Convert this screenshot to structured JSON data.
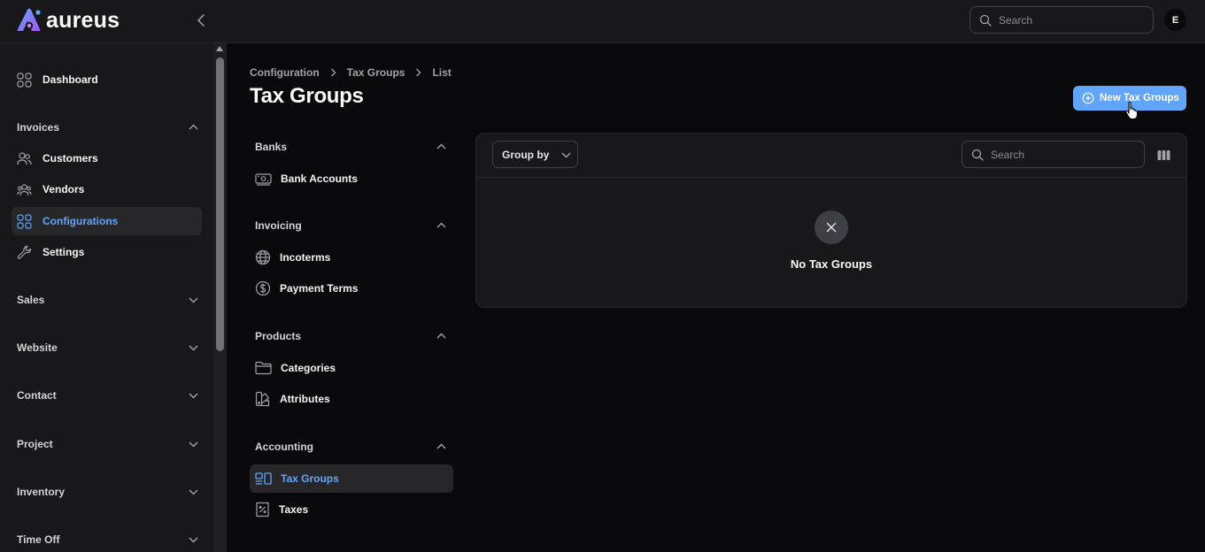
{
  "app": {
    "name": "aureus",
    "user_initial": "E",
    "search_placeholder": "Search"
  },
  "sidebar": {
    "top_items": [
      {
        "label": "Dashboard",
        "icon": "grid-icon"
      }
    ],
    "groups": [
      {
        "label": "Invoices",
        "expanded": true,
        "items": [
          {
            "label": "Customers",
            "icon": "users-icon"
          },
          {
            "label": "Vendors",
            "icon": "user-group-icon"
          },
          {
            "label": "Configurations",
            "icon": "grid-icon",
            "active": true
          },
          {
            "label": "Settings",
            "icon": "wrench-icon"
          }
        ]
      },
      {
        "label": "Sales",
        "expanded": false
      },
      {
        "label": "Website",
        "expanded": false
      },
      {
        "label": "Contact",
        "expanded": false
      },
      {
        "label": "Project",
        "expanded": false
      },
      {
        "label": "Inventory",
        "expanded": false
      },
      {
        "label": "Time Off",
        "expanded": false
      }
    ]
  },
  "breadcrumb": [
    "Configuration",
    "Tax Groups",
    "List"
  ],
  "page": {
    "title": "Tax Groups",
    "new_button": "New Tax Groups"
  },
  "subnav": [
    {
      "label": "Banks",
      "items": [
        {
          "label": "Bank Accounts",
          "icon": "bank-icon"
        }
      ]
    },
    {
      "label": "Invoicing",
      "items": [
        {
          "label": "Incoterms",
          "icon": "globe-icon"
        },
        {
          "label": "Payment Terms",
          "icon": "dollar-icon"
        }
      ]
    },
    {
      "label": "Products",
      "items": [
        {
          "label": "Categories",
          "icon": "folder-icon"
        },
        {
          "label": "Attributes",
          "icon": "swatch-icon"
        }
      ]
    },
    {
      "label": "Accounting",
      "items": [
        {
          "label": "Tax Groups",
          "icon": "tax-groups-icon",
          "active": true
        },
        {
          "label": "Taxes",
          "icon": "receipt-percent-icon"
        }
      ]
    }
  ],
  "table": {
    "group_by_label": "Group by",
    "search_placeholder": "Search",
    "empty_message": "No Tax Groups"
  },
  "colors": {
    "accent": "#60a5fa",
    "background": "#09090b",
    "surface": "#18181b"
  }
}
